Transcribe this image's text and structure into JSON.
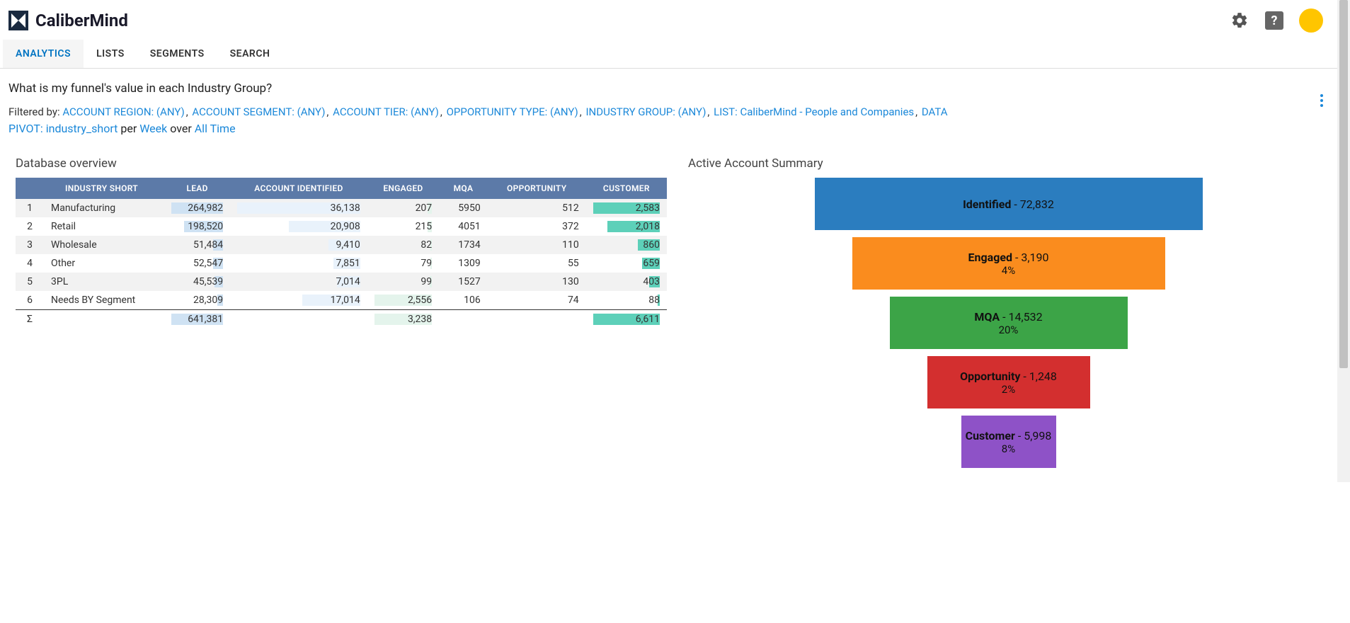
{
  "brand": "CaliberMind",
  "tabs": [
    "ANALYTICS",
    "LISTS",
    "SEGMENTS",
    "SEARCH"
  ],
  "active_tab": 0,
  "question": "What is my funnel's value in each Industry Group?",
  "filters": {
    "prefix": "Filtered by:",
    "items": [
      "ACCOUNT REGION: (ANY)",
      "ACCOUNT SEGMENT: (ANY)",
      "ACCOUNT TIER: (ANY)",
      "OPPORTUNITY TYPE: (ANY)",
      "INDUSTRY GROUP: (ANY)",
      "LIST: CaliberMind - People and Companies",
      "DATA"
    ],
    "pivot": "PIVOT: industry_short",
    "per_word": "per",
    "per_value": "Week",
    "over_word": "over",
    "over_value": "All Time"
  },
  "table": {
    "title": "Database overview",
    "headers": [
      "INDUSTRY SHORT",
      "LEAD",
      "ACCOUNT IDENTIFIED",
      "ENGAGED",
      "MQA",
      "OPPORTUNITY",
      "CUSTOMER"
    ],
    "rows": [
      {
        "idx": "1",
        "name": "Manufacturing",
        "lead": "264,982",
        "acct": "36,138",
        "eng": "207",
        "mqa": "5950",
        "opp": "512",
        "cust": "2,583",
        "lead_w": 100,
        "acct_w": 100,
        "eng_w": 8,
        "cust_w": 100
      },
      {
        "idx": "2",
        "name": "Retail",
        "lead": "198,520",
        "acct": "20,908",
        "eng": "215",
        "mqa": "4051",
        "opp": "372",
        "cust": "2,018",
        "lead_w": 75,
        "acct_w": 58,
        "eng_w": 8,
        "cust_w": 78
      },
      {
        "idx": "3",
        "name": "Wholesale",
        "lead": "51,484",
        "acct": "9,410",
        "eng": "82",
        "mqa": "1734",
        "opp": "110",
        "cust": "860",
        "lead_w": 19,
        "acct_w": 26,
        "eng_w": 3,
        "cust_w": 33
      },
      {
        "idx": "4",
        "name": "Other",
        "lead": "52,547",
        "acct": "7,851",
        "eng": "79",
        "mqa": "1309",
        "opp": "55",
        "cust": "659",
        "lead_w": 20,
        "acct_w": 22,
        "eng_w": 3,
        "cust_w": 26
      },
      {
        "idx": "5",
        "name": "3PL",
        "lead": "45,539",
        "acct": "7,014",
        "eng": "99",
        "mqa": "1527",
        "opp": "130",
        "cust": "403",
        "lead_w": 17,
        "acct_w": 19,
        "eng_w": 4,
        "cust_w": 16
      },
      {
        "idx": "6",
        "name": "Needs BY Segment",
        "lead": "28,309",
        "acct": "17,014",
        "eng": "2,556",
        "mqa": "106",
        "opp": "74",
        "cust": "88",
        "lead_w": 11,
        "acct_w": 47,
        "eng_w": 100,
        "cust_w": 3
      }
    ],
    "total": {
      "sym": "Σ",
      "lead": "641,381",
      "eng": "3,238",
      "cust": "6,611"
    }
  },
  "funnel": {
    "title": "Active Account Summary",
    "steps": [
      {
        "label": "Identified",
        "value": "72,832",
        "pct": ""
      },
      {
        "label": "Engaged",
        "value": "3,190",
        "pct": "4%"
      },
      {
        "label": "MQA",
        "value": "14,532",
        "pct": "20%"
      },
      {
        "label": "Opportunity",
        "value": "1,248",
        "pct": "2%"
      },
      {
        "label": "Customer",
        "value": "5,998",
        "pct": "8%"
      }
    ]
  },
  "chart_data": {
    "type": "bar",
    "title": "Active Account Summary",
    "categories": [
      "Identified",
      "Engaged",
      "MQA",
      "Opportunity",
      "Customer"
    ],
    "values": [
      72832,
      3190,
      14532,
      1248,
      5998
    ],
    "conversion_pct": [
      null,
      4,
      20,
      2,
      8
    ]
  }
}
